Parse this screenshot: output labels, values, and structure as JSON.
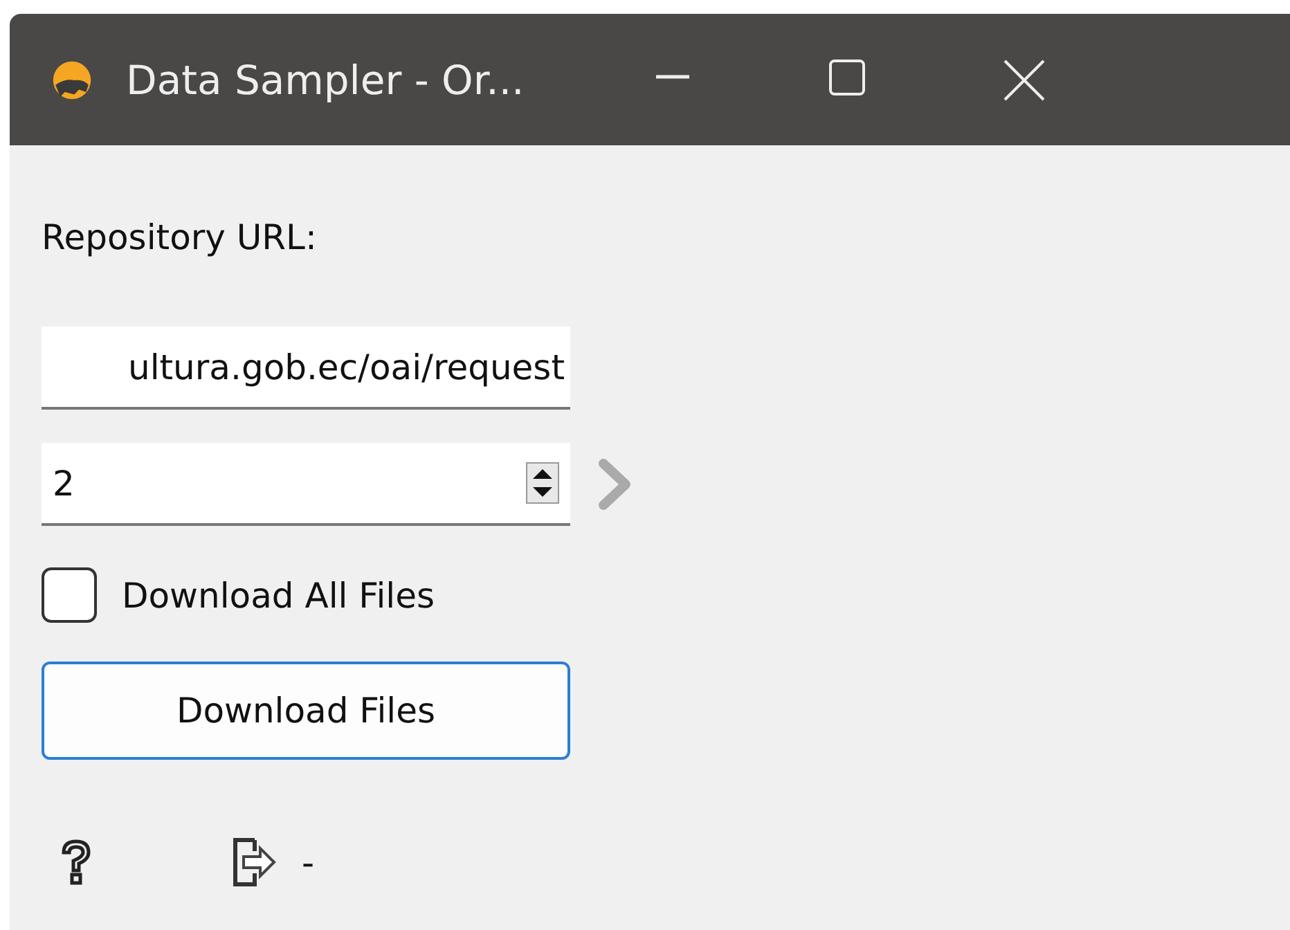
{
  "window": {
    "title": "Data Sampler - Or..."
  },
  "repository": {
    "label": "Repository URL:",
    "value": "ultura.gob.ec/oai/request"
  },
  "count": {
    "value": "2"
  },
  "download_all": {
    "label": "Download All Files",
    "checked": false
  },
  "download_button": {
    "label": "Download Files"
  },
  "status": {
    "output": "-"
  }
}
